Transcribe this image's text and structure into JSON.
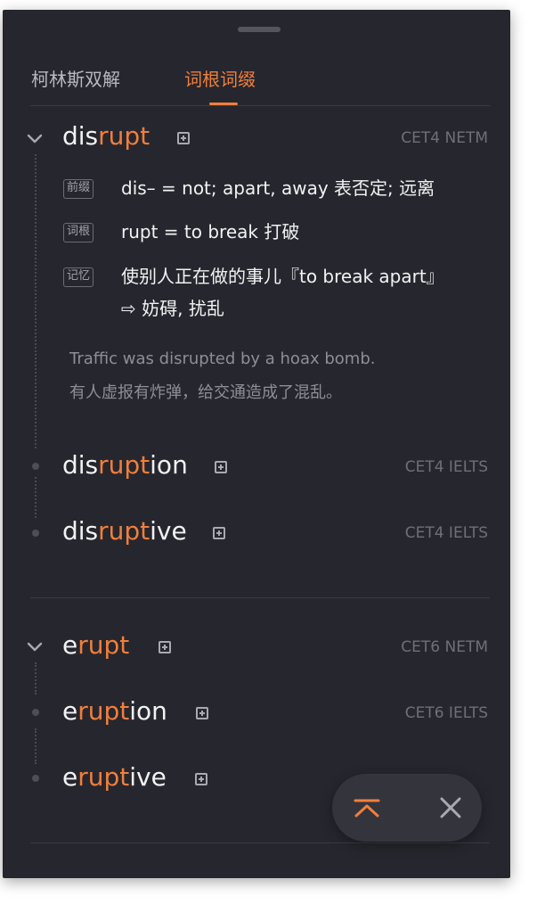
{
  "tabs": [
    {
      "label": "柯林斯双解",
      "active": false
    },
    {
      "label": "词根词缀",
      "active": true
    }
  ],
  "groups": [
    {
      "main": {
        "prefix": "dis",
        "root": "rupt",
        "suffix": "",
        "tags": "CET4 NETM"
      },
      "details": [
        {
          "badge": "前缀",
          "text": "dis– = not; apart, away  表否定; 远离"
        },
        {
          "badge": "词根",
          "text": "rupt = to break  打破"
        },
        {
          "badge": "记忆",
          "text": "使别人正在做的事儿『to break apart』",
          "text2": "⇨  妨碍, 扰乱"
        }
      ],
      "example": {
        "en": "Traffic was disrupted by a hoax bomb.",
        "zh": "有人虚报有炸弹，给交通造成了混乱。"
      },
      "derived": [
        {
          "prefix": "dis",
          "root": "rupt",
          "suffix": "ion",
          "tags": "CET4 IELTS"
        },
        {
          "prefix": "dis",
          "root": "rupt",
          "suffix": "ive",
          "tags": "CET4 IELTS"
        }
      ]
    },
    {
      "main": {
        "prefix": "e",
        "root": "rupt",
        "suffix": "",
        "tags": "CET6 NETM"
      },
      "derived": [
        {
          "prefix": "e",
          "root": "rupt",
          "suffix": "ion",
          "tags": "CET6 IELTS"
        },
        {
          "prefix": "e",
          "root": "rupt",
          "suffix": "ive",
          "tags": ""
        }
      ]
    }
  ],
  "colors": {
    "accent": "#f07f3c",
    "panel": "#26262e",
    "text": "#f2f2f4",
    "muted": "#6f6f78"
  },
  "icons": {
    "collapse": "chevron-down-icon",
    "add": "plus-square-icon",
    "top": "scroll-top-icon",
    "close": "close-icon"
  }
}
